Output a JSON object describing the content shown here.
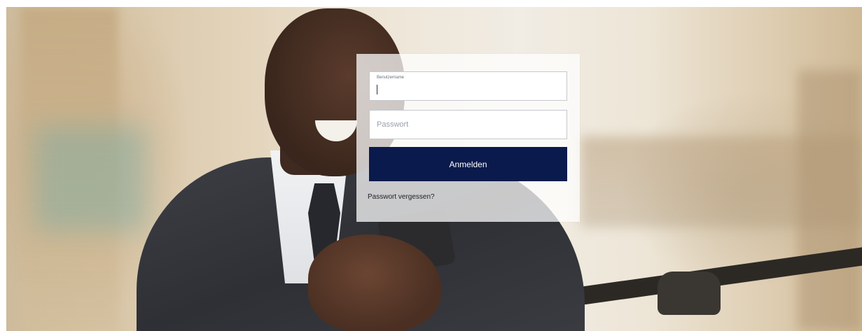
{
  "login": {
    "username_label": "Benutzername",
    "username_value": "",
    "password_placeholder": "Passwort",
    "submit_label": "Anmelden",
    "forgot_password_link": "Passwort vergessen?",
    "button_color": "#0b1a4c"
  }
}
